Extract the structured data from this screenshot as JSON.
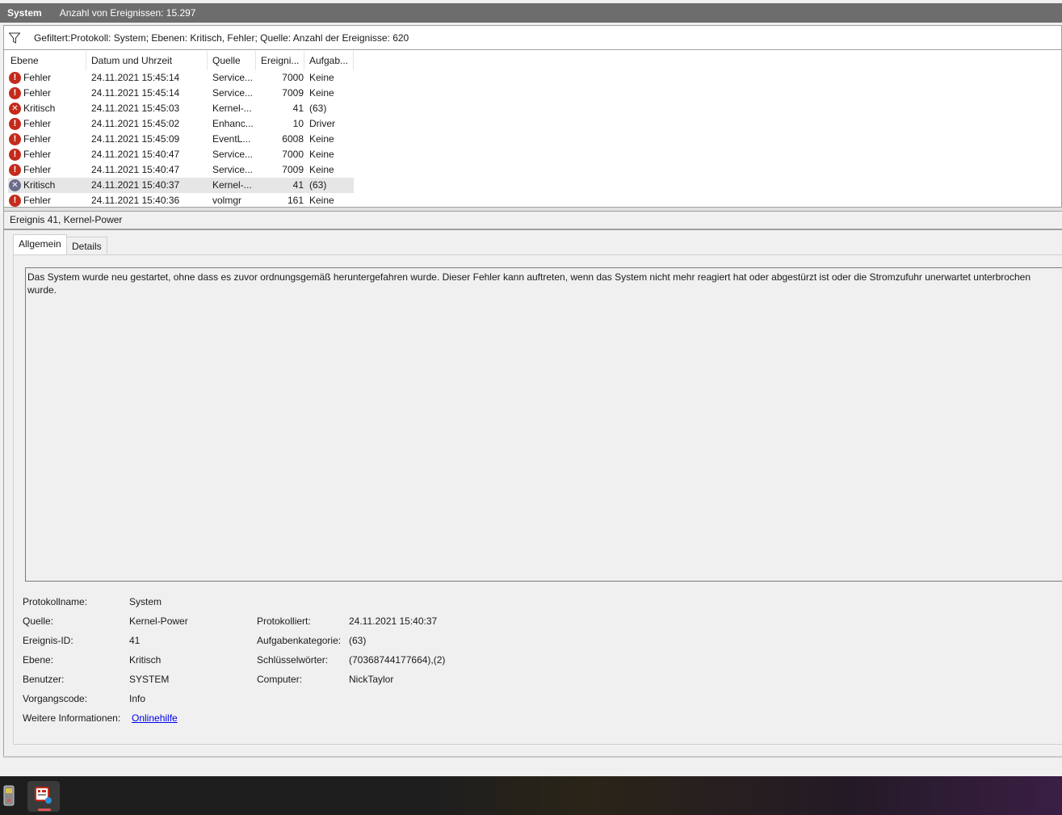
{
  "header": {
    "log_name": "System",
    "event_count_label": "Anzahl von Ereignissen: 15.297"
  },
  "filter": {
    "text": "Gefiltert:Protokoll: System; Ebenen: Kritisch, Fehler; Quelle:  Anzahl der Ereignisse: 620"
  },
  "columns": [
    "Ebene",
    "Datum und Uhrzeit",
    "Quelle",
    "Ereigni...",
    "Aufgab..."
  ],
  "events": [
    {
      "level": "Fehler",
      "datetime": "24.11.2021 15:45:14",
      "source": "Service...",
      "id": "7000",
      "task": "Keine"
    },
    {
      "level": "Fehler",
      "datetime": "24.11.2021 15:45:14",
      "source": "Service...",
      "id": "7009",
      "task": "Keine"
    },
    {
      "level": "Kritisch",
      "datetime": "24.11.2021 15:45:03",
      "source": "Kernel-...",
      "id": "41",
      "task": "(63)"
    },
    {
      "level": "Fehler",
      "datetime": "24.11.2021 15:45:02",
      "source": "Enhanc...",
      "id": "10",
      "task": "Driver"
    },
    {
      "level": "Fehler",
      "datetime": "24.11.2021 15:45:09",
      "source": "EventL...",
      "id": "6008",
      "task": "Keine"
    },
    {
      "level": "Fehler",
      "datetime": "24.11.2021 15:40:47",
      "source": "Service...",
      "id": "7000",
      "task": "Keine"
    },
    {
      "level": "Fehler",
      "datetime": "24.11.2021 15:40:47",
      "source": "Service...",
      "id": "7009",
      "task": "Keine"
    },
    {
      "level": "Kritisch",
      "datetime": "24.11.2021 15:40:37",
      "source": "Kernel-...",
      "id": "41",
      "task": "(63)",
      "selected": true
    },
    {
      "level": "Fehler",
      "datetime": "24.11.2021 15:40:36",
      "source": "volmgr",
      "id": "161",
      "task": "Keine"
    }
  ],
  "detail": {
    "title": "Ereignis 41, Kernel-Power",
    "tabs": [
      "Allgemein",
      "Details"
    ],
    "description": "Das System wurde neu gestartet, ohne dass es zuvor ordnungsgemäß heruntergefahren wurde. Dieser Fehler kann auftreten, wenn das System nicht mehr reagiert hat oder abgestürzt ist oder die Stromzufuhr unerwartet unterbrochen wurde.",
    "props": {
      "log_name_label": "Protokollname:",
      "log_name_value": "System",
      "source_label": "Quelle:",
      "source_value": "Kernel-Power",
      "logged_label": "Protokolliert:",
      "logged_value": "24.11.2021 15:40:37",
      "event_id_label": "Ereignis-ID:",
      "event_id_value": "41",
      "task_category_label": "Aufgabenkategorie:",
      "task_category_value": "(63)",
      "level_label": "Ebene:",
      "level_value": "Kritisch",
      "keywords_label": "Schlüsselwörter:",
      "keywords_value": "(70368744177664),(2)",
      "user_label": "Benutzer:",
      "user_value": "SYSTEM",
      "computer_label": "Computer:",
      "computer_value": "NickTaylor",
      "opcode_label": "Vorgangscode:",
      "opcode_value": "Info",
      "more_info_label": "Weitere Informationen:",
      "more_info_link": "Onlinehilfe"
    }
  },
  "icons": {
    "error": "exclamation-circle-icon",
    "critical": "x-circle-icon",
    "filter": "funnel-icon"
  },
  "colors": {
    "title_bar": "#6d6d6d",
    "error_red": "#c42b1c",
    "link": "#0000ee",
    "selected_row": "#e6e6e6"
  }
}
